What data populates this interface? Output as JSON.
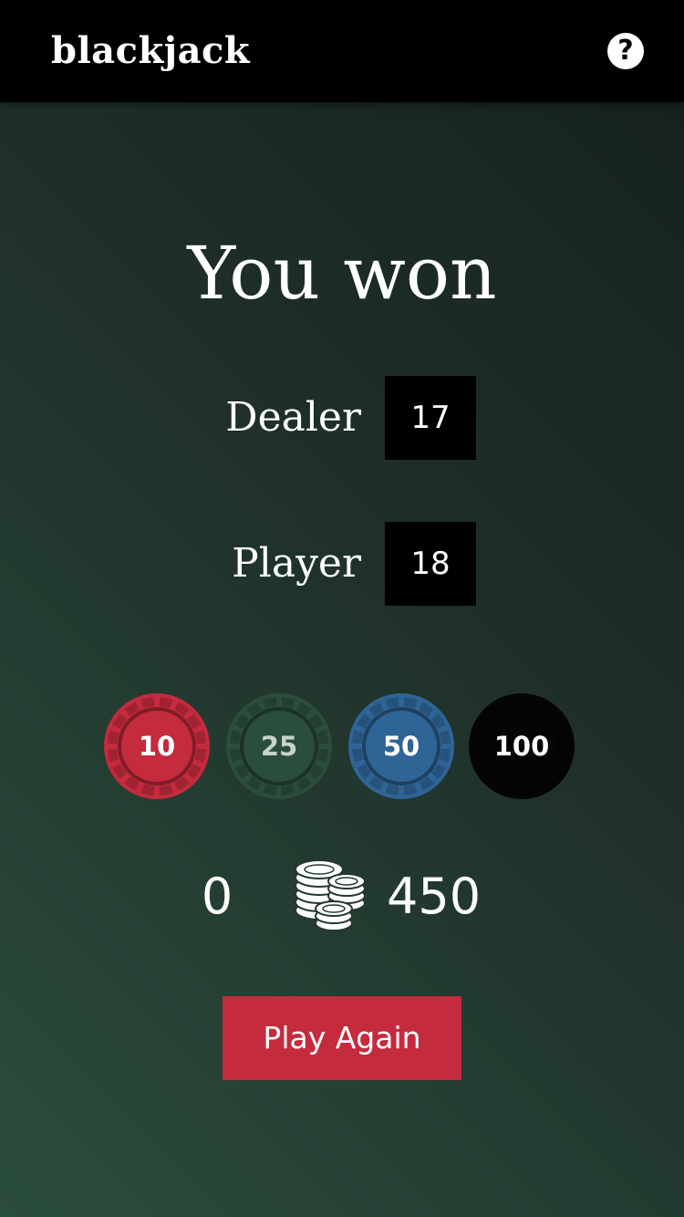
{
  "header": {
    "title": "blackjack",
    "help_label": "?"
  },
  "result": {
    "title": "You won"
  },
  "scores": {
    "dealer_label": "Dealer",
    "dealer_value": "17",
    "player_label": "Player",
    "player_value": "18"
  },
  "chips": [
    {
      "label": "10",
      "color": "#c42b3d",
      "text_color": "#ffffff"
    },
    {
      "label": "25",
      "color": "#2b4d3b",
      "text_color": "#c8d2cc"
    },
    {
      "label": "50",
      "color": "#2f6496",
      "text_color": "#ffffff"
    },
    {
      "label": "100",
      "color": "#050505",
      "text_color": "#ffffff"
    }
  ],
  "bank": {
    "bet": "0",
    "balance": "450",
    "icon": "coins-stack-icon"
  },
  "actions": {
    "play_again_label": "Play Again"
  },
  "colors": {
    "accent": "#c42b3d",
    "background": "#22382e",
    "header": "#000000"
  }
}
